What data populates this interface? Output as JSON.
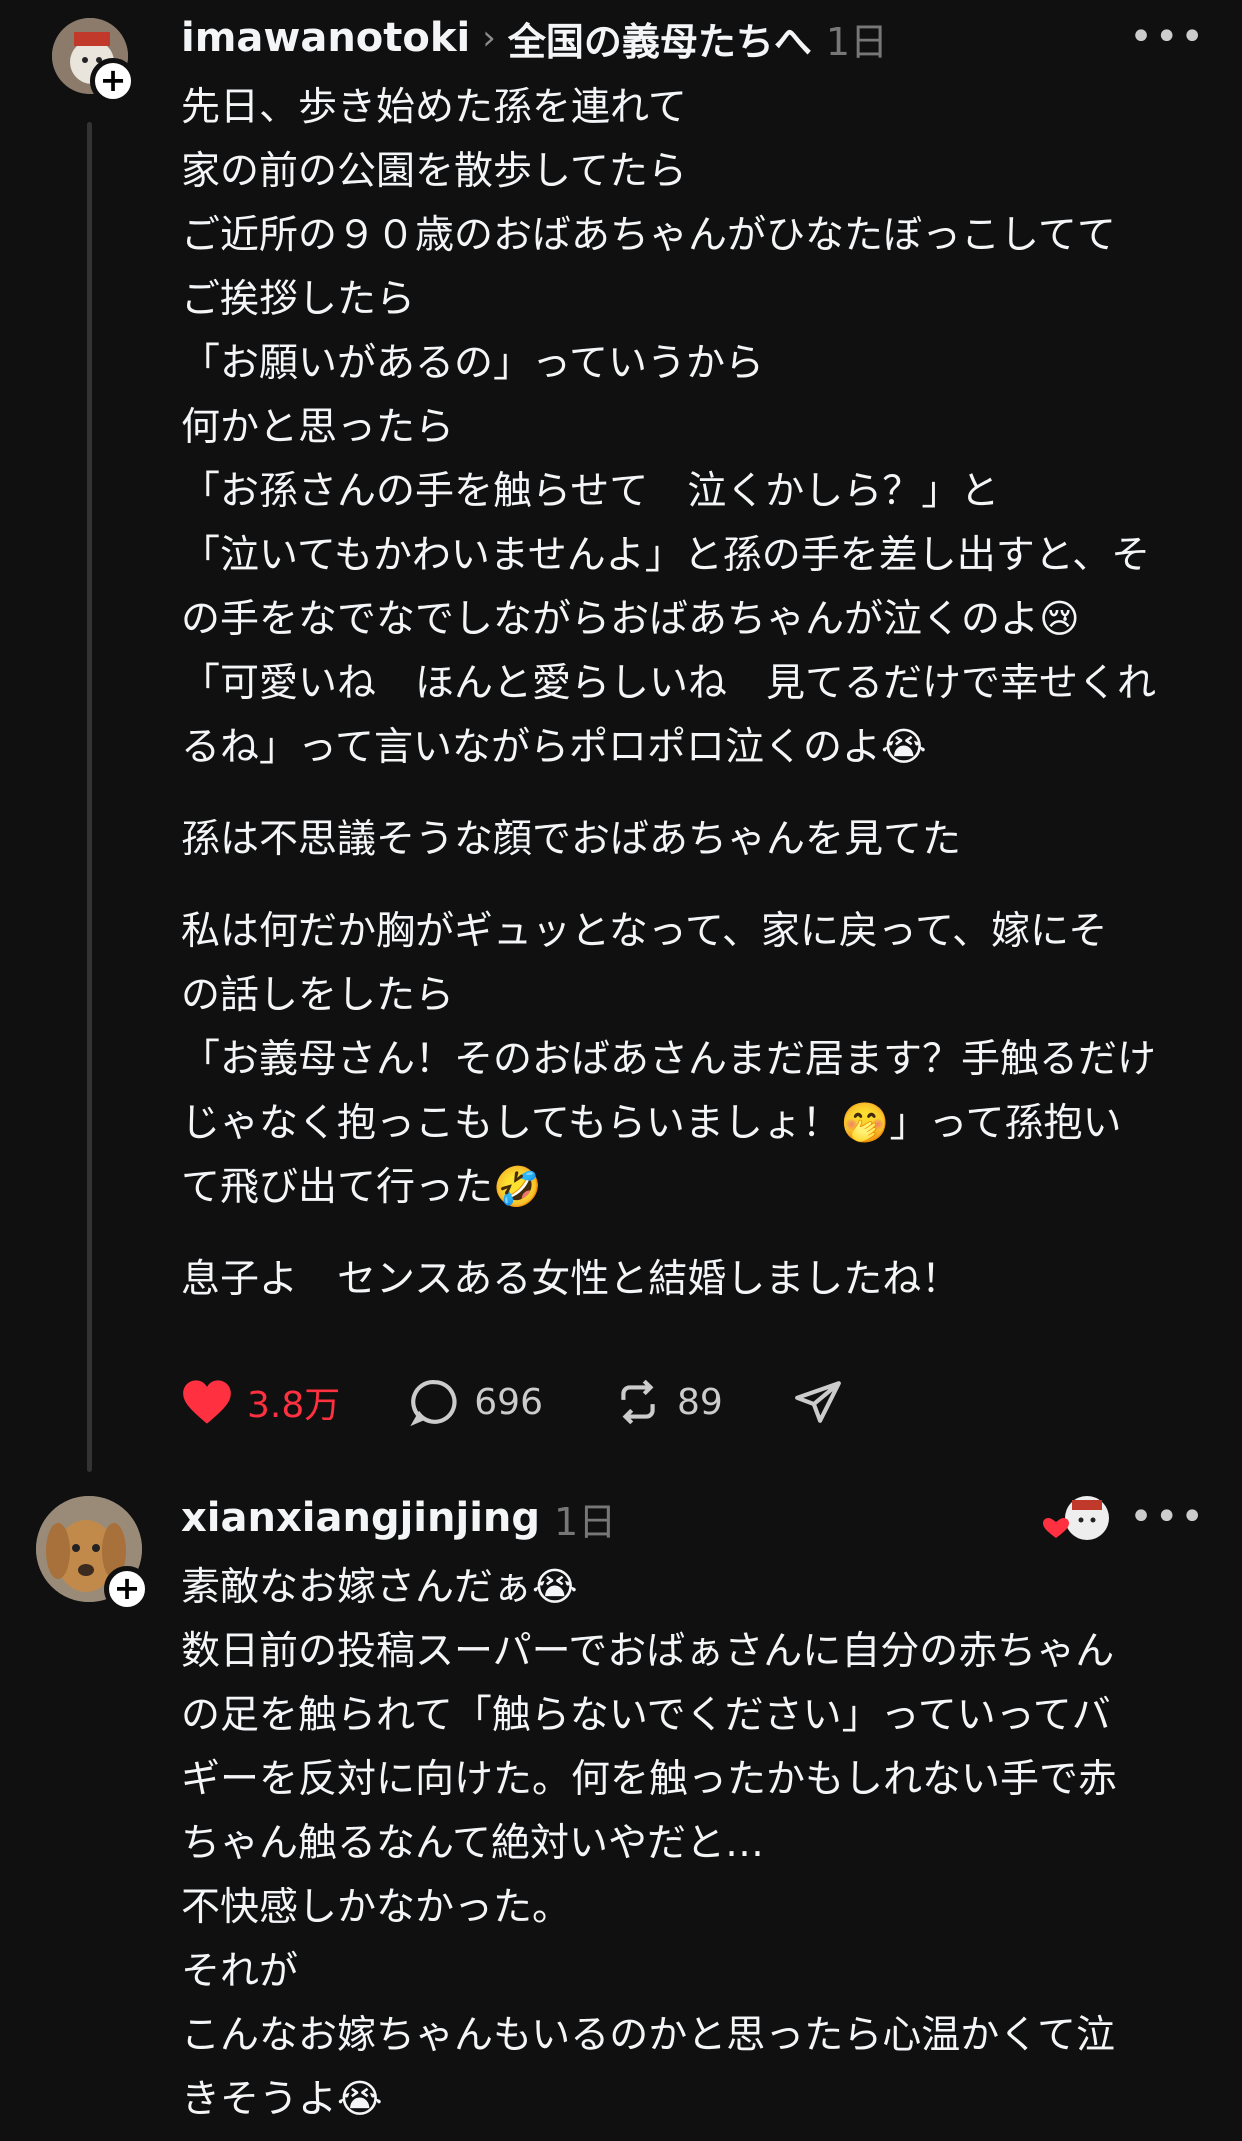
{
  "post": {
    "username": "imawanotoki",
    "topic": "全国の義母たちへ",
    "time": "1日",
    "lines": [
      "先日、歩き始めた孫を連れて",
      "家の前の公園を散歩してたら",
      "ご近所の９０歳のおばあちゃんがひなたぼっこしてて",
      "ご挨拶したら",
      "「お願いがあるの」っていうから",
      "何かと思ったら",
      "「お孫さんの手を触らせて　泣くかしら？」と",
      "「泣いてもかわいませんよ」と孫の手を差し出すと、そ",
      "の手をなでなでしながらおばあちゃんが泣くのよ😢",
      "「可愛いね　ほんと愛らしいね　見てるだけで幸せくれ",
      "るね」って言いながらポロポロ泣くのよ😭",
      "",
      "孫は不思議そうな顔でおばあちゃんを見てた",
      "",
      "私は何だか胸がギュッとなって、家に戻って、嫁にそ",
      "の話しをしたら",
      "「お義母さん！そのおばあさんまだ居ます？手触るだけ",
      "じゃなく抱っこもしてもらいましょ！🤭」って孫抱い",
      "て飛び出て行った🤣",
      "",
      "息子よ　センスある女性と結婚しましたね！"
    ],
    "likes": "3.8万",
    "comments": "696",
    "reposts": "89"
  },
  "reply": {
    "username": "xianxiangjinjing",
    "time": "1日",
    "lines": [
      "素敵なお嫁さんだぁ😭",
      "数日前の投稿スーパーでおばぁさんに自分の赤ちゃん",
      "の足を触られて「触らないでください」っていってバ",
      "ギーを反対に向けた。何を触ったかもしれない手で赤",
      "ちゃん触るなんて絶対いやだと…",
      "不快感しかなかった。",
      "それが",
      "こんなお嫁ちゃんもいるのかと思ったら心温かくて泣",
      "きそうよ😭"
    ]
  },
  "colors": {
    "background": "#101010",
    "text": "#f3f5f7",
    "muted": "#777777",
    "like": "#ff3040"
  },
  "icons": [
    "plus-icon",
    "chevron-right-icon",
    "more-icon",
    "heart-icon",
    "comment-icon",
    "repost-icon",
    "share-icon"
  ]
}
